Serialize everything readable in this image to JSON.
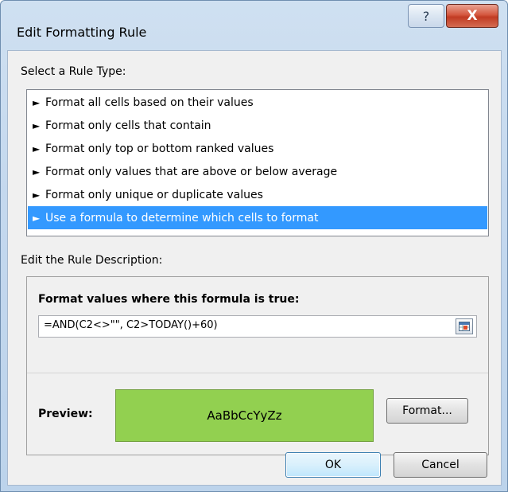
{
  "window": {
    "title": "Edit Formatting Rule",
    "help_glyph": "?",
    "close_glyph": "X"
  },
  "rule_type": {
    "label": "Select a Rule Type:",
    "items": [
      {
        "label": "Format all cells based on their values",
        "selected": false
      },
      {
        "label": "Format only cells that contain",
        "selected": false
      },
      {
        "label": "Format only top or bottom ranked values",
        "selected": false
      },
      {
        "label": "Format only values that are above or below average",
        "selected": false
      },
      {
        "label": "Format only unique or duplicate values",
        "selected": false
      },
      {
        "label": "Use a formula to determine which cells to format",
        "selected": true
      }
    ]
  },
  "description": {
    "label": "Edit the Rule Description:",
    "formula_title": "Format values where this formula is true:",
    "formula_value": "=AND(C2<>\"\", C2>TODAY()+60)",
    "preview_label": "Preview:",
    "preview_text": "AaBbCcYyZz",
    "preview_fill": "#92d050",
    "format_button": "Format..."
  },
  "buttons": {
    "ok": "OK",
    "cancel": "Cancel"
  },
  "colors": {
    "selection": "#3399ff"
  }
}
